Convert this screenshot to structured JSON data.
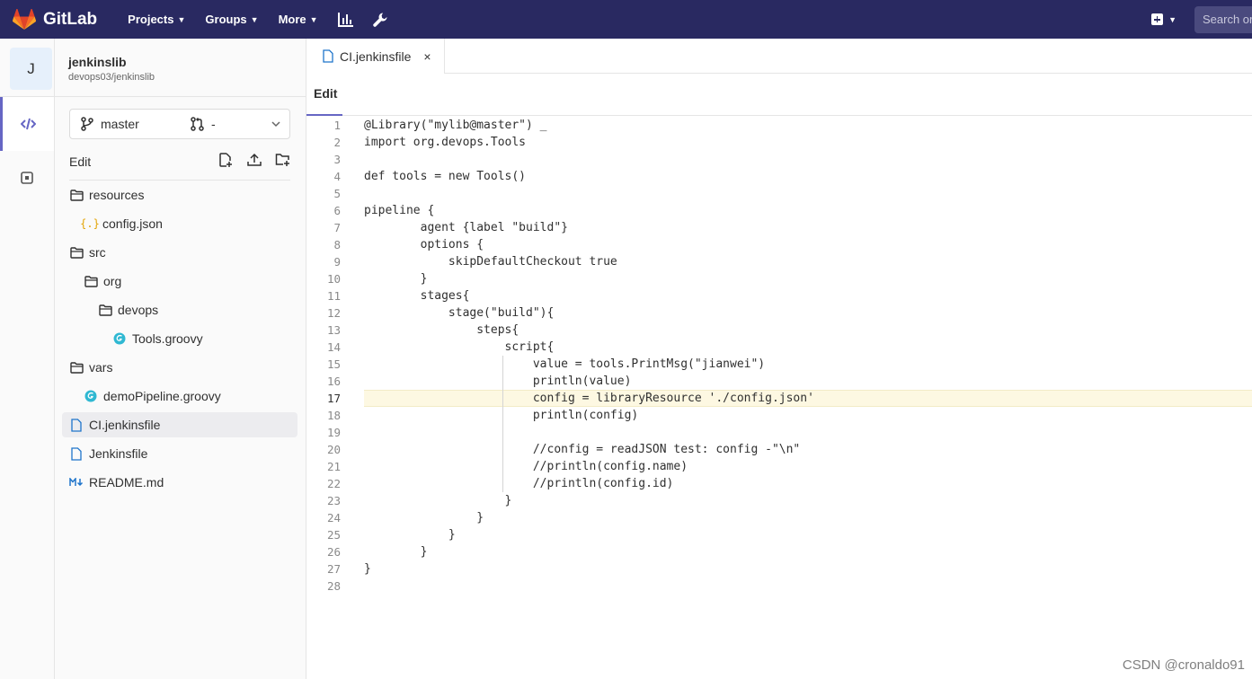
{
  "topnav": {
    "brand": "GitLab",
    "projects": "Projects",
    "groups": "Groups",
    "more": "More",
    "search_placeholder": "Search or jump to..."
  },
  "project": {
    "avatar_letter": "J",
    "name": "jenkinslib",
    "path": "devops03/jenkinslib"
  },
  "branch": {
    "name": "master",
    "merge_request": "-"
  },
  "tree": {
    "edit_label": "Edit",
    "nodes": [
      {
        "label": "resources",
        "icon": "folder-icon"
      },
      {
        "label": "config.json",
        "icon": "json-icon"
      },
      {
        "label": "src",
        "icon": "folder-icon"
      },
      {
        "label": "org",
        "icon": "folder-icon"
      },
      {
        "label": "devops",
        "icon": "folder-icon"
      },
      {
        "label": "Tools.groovy",
        "icon": "groovy-icon"
      },
      {
        "label": "vars",
        "icon": "folder-icon"
      },
      {
        "label": "demoPipeline.groovy",
        "icon": "groovy-icon"
      },
      {
        "label": "CI.jenkinsfile",
        "icon": "file-icon"
      },
      {
        "label": "Jenkinsfile",
        "icon": "file-icon"
      },
      {
        "label": "README.md",
        "icon": "markdown-icon"
      }
    ]
  },
  "editor": {
    "tab_label": "CI.jenkinsfile",
    "close_symbol": "×",
    "mode": "Edit",
    "current_line": 17,
    "lines": [
      "@Library(\"mylib@master\") _",
      "import org.devops.Tools",
      "",
      "def tools = new Tools()",
      "",
      "pipeline {",
      "        agent {label \"build\"}",
      "        options {",
      "            skipDefaultCheckout true",
      "        }",
      "        stages{",
      "            stage(\"build\"){",
      "                steps{",
      "                    script{",
      "                        value = tools.PrintMsg(\"jianwei\")",
      "                        println(value)",
      "                        config = libraryResource './config.json'",
      "                        println(config)",
      "",
      "                        //config = readJSON test: config -\"\\n\"",
      "                        //println(config.name)",
      "                        //println(config.id)",
      "                    }",
      "                }",
      "            }",
      "        }",
      "}",
      ""
    ]
  },
  "watermark": "CSDN @cronaldo91",
  "colors": {
    "nav_bg": "#292961",
    "accent": "#6666c4",
    "highlight_line": "#fdf8e2"
  }
}
